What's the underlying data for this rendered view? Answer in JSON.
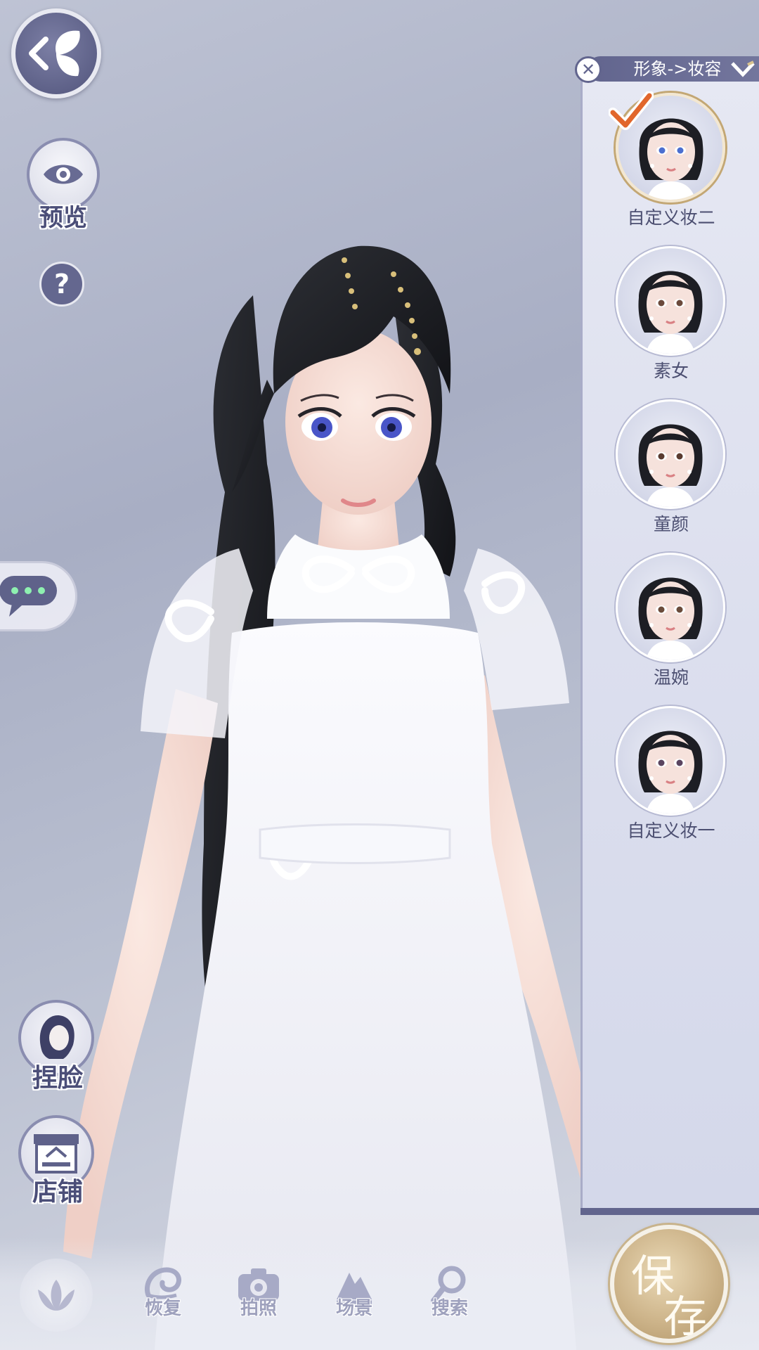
{
  "left_menu": {
    "preview_label": "预览",
    "help_label": "?",
    "face_label": "捏脸",
    "shop_label": "店铺"
  },
  "bottom_bar": {
    "restore_label": "恢复",
    "photo_label": "拍照",
    "scene_label": "场景",
    "search_label": "搜索"
  },
  "panel": {
    "title": "形象->妆容",
    "close_symbol": "✕",
    "items": [
      {
        "label": "自定义妆二",
        "selected": true,
        "eye_color": "#4b6fd0"
      },
      {
        "label": "素女",
        "selected": false,
        "eye_color": "#6b4a3c"
      },
      {
        "label": "童颜",
        "selected": false,
        "eye_color": "#5a3b30"
      },
      {
        "label": "温婉",
        "selected": false,
        "eye_color": "#6a4b3a"
      },
      {
        "label": "自定义妆一",
        "selected": false,
        "eye_color": "#5a4560"
      }
    ]
  },
  "save": {
    "char1": "保",
    "char2": "存"
  },
  "colors": {
    "accent": "#62658e",
    "gold": "#c3a774",
    "panel_bg": "#dcdfee"
  }
}
